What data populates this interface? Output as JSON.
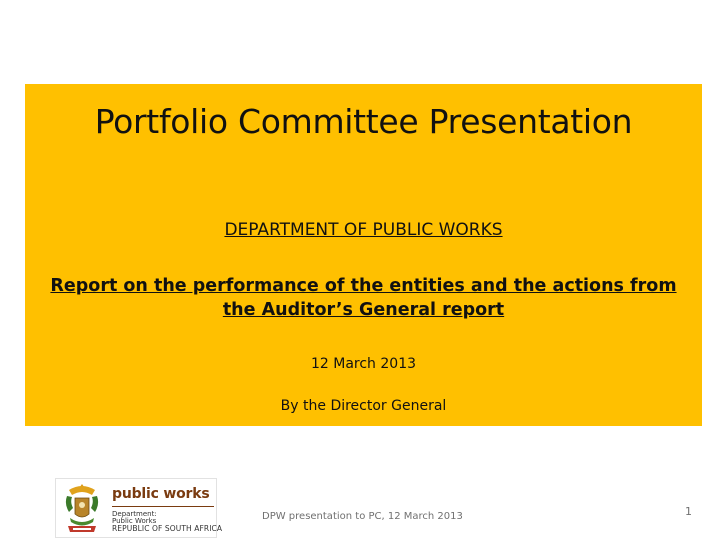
{
  "slide": {
    "title": "Portfolio Committee Presentation",
    "department": "DEPARTMENT OF PUBLIC WORKS",
    "report_line1": "Report on the performance of the entities and the actions from",
    "report_line2": "the Auditor’s General report",
    "date": "12 March 2013",
    "byline": "By the Director General"
  },
  "logo": {
    "title": "public works",
    "line1": "Department:",
    "line2": "Public Works",
    "line3": "REPUBLIC OF SOUTH AFRICA"
  },
  "footer": {
    "text": "DPW presentation to PC, 12 March 2013",
    "page_number": "1"
  },
  "colors": {
    "banner": "#FFC000",
    "logo_text": "#7a3b10",
    "footer_text": "#707070"
  }
}
